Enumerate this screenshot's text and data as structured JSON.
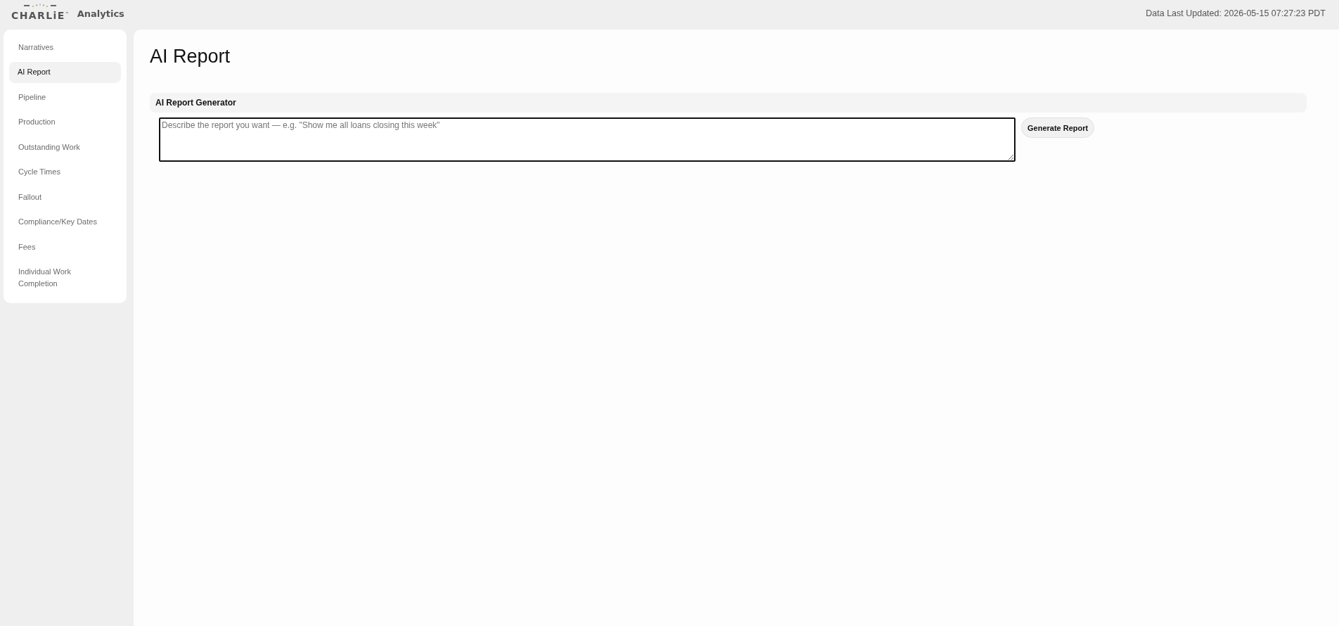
{
  "header": {
    "logo": {
      "wordmark": "CHARLiE$^{™}$"
    },
    "app_name": "Analytics",
    "last_updated": "Data Last Updated: 2026-05-15 07:27:23 PDT"
  },
  "sidebar": {
    "items": [
      {
        "label": "Narratives",
        "selected": false
      },
      {
        "label": "AI Report",
        "selected": true
      },
      {
        "label": "Pipeline",
        "selected": false
      },
      {
        "label": "Production",
        "selected": false
      },
      {
        "label": "Outstanding Work",
        "selected": false
      },
      {
        "label": "Cycle Times",
        "selected": false
      },
      {
        "label": "Fallout",
        "selected": false
      },
      {
        "label": "Compliance/Key Dates",
        "selected": false
      },
      {
        "label": "Fees",
        "selected": false
      },
      {
        "label": "Individual Work Completion",
        "selected": false
      }
    ]
  },
  "page": {
    "title": "AI Report"
  },
  "generator": {
    "title": "AI Report Generator",
    "prompt": {
      "placeholder": "Describe the report you want — e.g. \"Show me all loans closing this week\""
    },
    "button": "Generate Report"
  }
}
